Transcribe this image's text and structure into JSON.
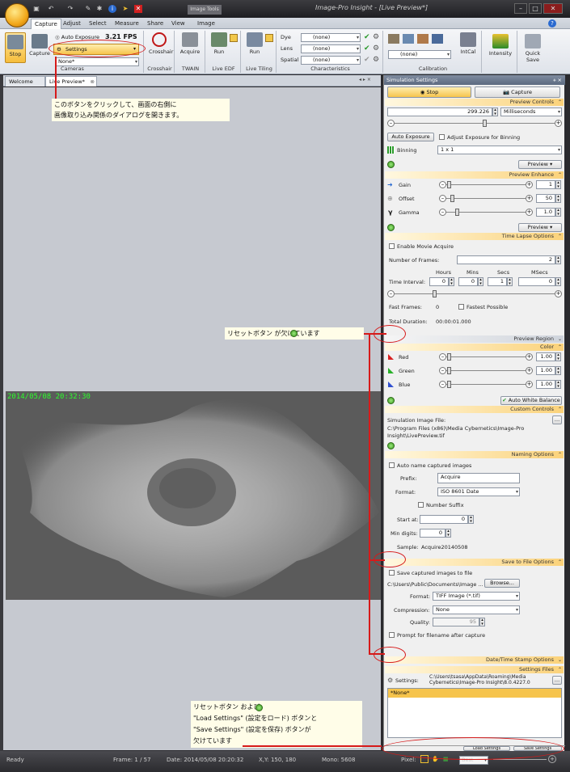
{
  "window": {
    "title": "Image-Pro Insight - [Live Preview*]",
    "context_tab": "Image Tools"
  },
  "ribbon_tabs": [
    "Capture",
    "Adjust",
    "Select",
    "Measure",
    "Share",
    "View",
    "Image"
  ],
  "ribbon": {
    "cameras": {
      "stop": "Stop",
      "capture": "Capture",
      "auto_exposure": "Auto Exposure",
      "fps": "3.21 FPS",
      "settings": "Settings",
      "camera_select": "None*",
      "label": "Cameras"
    },
    "crosshair": {
      "button": "Crosshair",
      "label": "Crosshair"
    },
    "twain": {
      "button": "Acquire",
      "label": "TWAIN"
    },
    "live_edf": {
      "button": "Run",
      "label": "Live EDF"
    },
    "live_tiling": {
      "button": "Run",
      "label": "Live Tiling"
    },
    "characteristics": {
      "rows": [
        {
          "name": "Dye",
          "value": "(none)"
        },
        {
          "name": "Lens",
          "value": "(none)"
        },
        {
          "name": "Spatial",
          "value": "(none)"
        }
      ],
      "label": "Characteristics"
    },
    "calibration": {
      "combo": "(none)",
      "intcal": "IntCal",
      "label": "Calibration"
    },
    "intensity": "Intensity",
    "quick_save": "Quick Save"
  },
  "doc_tabs": [
    "Welcome",
    "Live Preview*"
  ],
  "image": {
    "timestamp": "2014/05/08 20:32:30"
  },
  "panel": {
    "title": "Simulation Settings",
    "stop_tab": "Stop",
    "capture_tab": "Capture",
    "preview_controls": {
      "header": "Preview Controls",
      "exposure_value": "299.226",
      "exposure_unit": "Milliseconds",
      "auto_exposure": "Auto Exposure",
      "adjust_binning": "Adjust Exposure for Binning",
      "binning_label": "Binning",
      "binning_value": "1 x 1",
      "preview_btn": "Preview"
    },
    "preview_enhance": {
      "header": "Preview Enhance",
      "gain_label": "Gain",
      "gain": "1",
      "offset_label": "Offset",
      "offset": "50",
      "gamma_label": "Gamma",
      "gamma": "1.0",
      "preview_btn": "Preview"
    },
    "time_lapse": {
      "header": "Time Lapse Options",
      "enable_movie": "Enable Movie Acquire",
      "frames_label": "Number of Frames:",
      "frames": "2",
      "cols": [
        "Hours",
        "Mins",
        "Secs",
        "MSecs"
      ],
      "interval_label": "Time Interval:",
      "hours": "0",
      "mins": "0",
      "secs": "1",
      "msecs": "0",
      "fast_frames_label": "Fast Frames:",
      "fast_frames": "0",
      "fastest_possible": "Fastest Possible",
      "total_label": "Total Duration:",
      "total": "00:00:01.000"
    },
    "preview_region": {
      "header": "Preview Region"
    },
    "color": {
      "header": "Color",
      "red_label": "Red",
      "red": "1.00",
      "green_label": "Green",
      "green": "1.00",
      "blue_label": "Blue",
      "blue": "1.00",
      "awb": "Auto White Balance"
    },
    "custom_controls": {
      "header": "Custom Controls",
      "sim_label": "Simulation Image File:",
      "sim_path": "C:\\Program Files (x86)\\Media Cybernetics\\Image-Pro Insight\\LivePreview.tif"
    },
    "naming": {
      "header": "Naming Options",
      "auto_name": "Auto name captured images",
      "prefix_label": "Prefix:",
      "prefix": "Acquire",
      "format_label": "Format:",
      "format": "ISO 8601 Date",
      "number_suffix": "Number Suffix",
      "start_label": "Start at:",
      "start": "0",
      "digits_label": "Min digits:",
      "digits": "0",
      "sample_label": "Sample:",
      "sample": "Acquire20140508"
    },
    "save_to_file": {
      "header": "Save to File Options",
      "save_captured": "Save captured images to file",
      "path": "C:\\Users\\Public\\Documents\\Image ...",
      "browse": "Browse...",
      "format_label": "Format:",
      "format": "TIFF Image (*.tif)",
      "compression_label": "Compression:",
      "compression": "None",
      "quality_label": "Quality:",
      "quality": "95",
      "prompt": "Prompt for filename after capture"
    },
    "datetime_stamp": {
      "header": "Date/Time Stamp Options"
    },
    "settings_files": {
      "header": "Settings Files",
      "settings_label": "Settings:",
      "settings_path": "C:\\Users\\tsasa\\AppData\\Roaming\\Media Cybernetics\\Image-Pro Insight\\8.0.4227.0",
      "selected": "*None*",
      "load": "Load Settings",
      "save": "Save Settings"
    },
    "footer": {
      "pixel": "Pixel:",
      "zoom": "Best"
    }
  },
  "status": {
    "ready": "Ready",
    "frame": "Frame: 1 / 57",
    "date": "Date: 2014/05/08 20:20:32",
    "xy": "X,Y:  150,  180",
    "mono": "Mono:  5608"
  },
  "annotations": {
    "settings_note": "このボタンをクリックして、画面の右側に\n画像取り込み関係のダイアログを開きます。",
    "reset_missing": "リセットボタン  が欠けています",
    "bottom_note": "リセットボタン  および\n\"Load Settings\" (設定をロード) ボタンと\n\"Save Settings\" (設定を保存) ボタンが\n欠けています"
  }
}
